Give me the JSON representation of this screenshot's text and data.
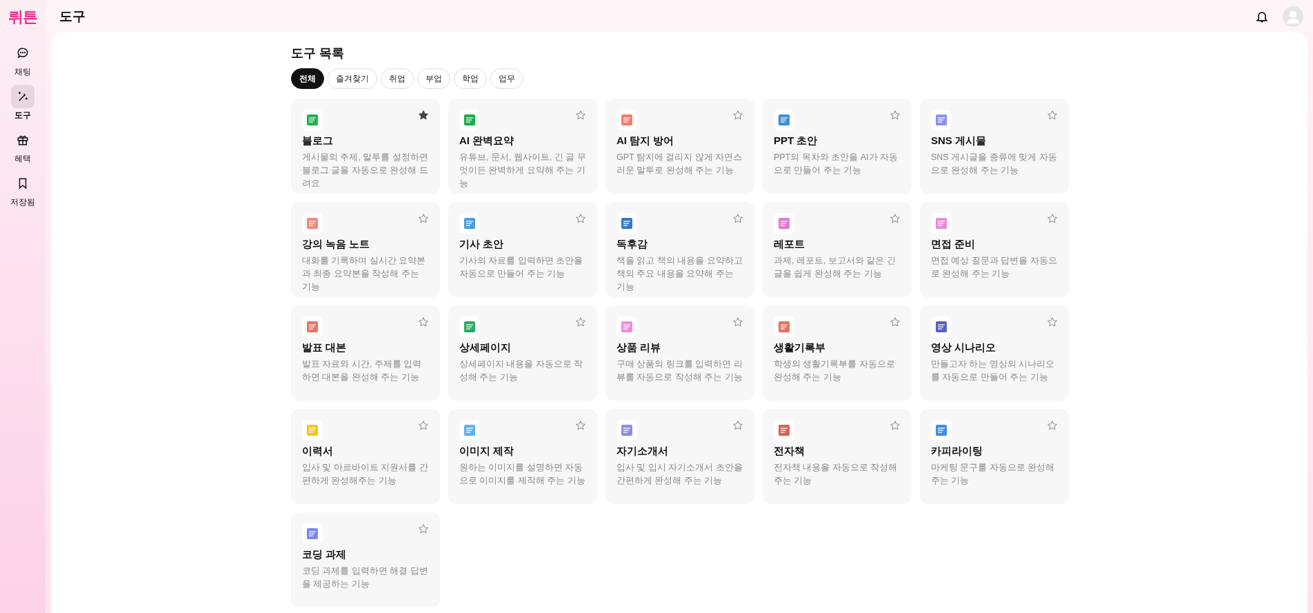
{
  "logo": "뤼튼",
  "header": {
    "title": "도구"
  },
  "sidebar": {
    "items": [
      {
        "label": "채팅",
        "selected": false
      },
      {
        "label": "도구",
        "selected": true
      },
      {
        "label": "혜택",
        "selected": false
      },
      {
        "label": "저장됨",
        "selected": false
      }
    ]
  },
  "section_title": "도구 목록",
  "filters": [
    {
      "label": "전체",
      "selected": true
    },
    {
      "label": "즐겨찾기",
      "selected": false
    },
    {
      "label": "취업",
      "selected": false
    },
    {
      "label": "부업",
      "selected": false
    },
    {
      "label": "학업",
      "selected": false
    },
    {
      "label": "업무",
      "selected": false
    }
  ],
  "tools": [
    {
      "title": "블로그",
      "description": "게시물의 주제, 말투를 설정하면 블로그 글을 자동으로 완성해 드려요",
      "favorite": true
    },
    {
      "title": "AI 완벽요약",
      "description": "유튜브, 문서, 웹사이트, 긴 글 무엇이든 완벽하게 요약해 주는 기능",
      "favorite": false
    },
    {
      "title": "AI 탐지 방어",
      "description": "GPT 탐지에 걸리지 않게 자연스러운 말투로 완성해 주는 기능",
      "favorite": false
    },
    {
      "title": "PPT 초안",
      "description": "PPT의 목차와 초안을 AI가 자동으로 만들어 주는 기능",
      "favorite": false
    },
    {
      "title": "SNS 게시물",
      "description": "SNS 게시글을 종류에 맞게 자동으로 완성해 주는 기능",
      "favorite": false
    },
    {
      "title": "강의 녹음 노트",
      "description": "대화를 기록하며 실시간 요약본과 최종 요약본을 작성해 주는 기능",
      "favorite": false
    },
    {
      "title": "기사 초안",
      "description": "기사의 자료를 입력하면 초안을 자동으로 만들어 주는 기능",
      "favorite": false
    },
    {
      "title": "독후감",
      "description": "책을 읽고 책의 내용을 요약하고 책의 주요 내용을 요약해 주는 기능",
      "favorite": false
    },
    {
      "title": "레포트",
      "description": "과제, 레포트, 보고서와 같은 긴 글을 쉽게 완성해 주는 기능",
      "favorite": false
    },
    {
      "title": "면접 준비",
      "description": "면접 예상 질문과 답변을 자동으로 완성해 주는 기능",
      "favorite": false
    },
    {
      "title": "발표 대본",
      "description": "발표 자료와 시간, 주제를 입력하면 대본을 완성해 주는 기능",
      "favorite": false
    },
    {
      "title": "상세페이지",
      "description": "상세페이지 내용을 자동으로 작성해 주는 기능",
      "favorite": false
    },
    {
      "title": "상품 리뷰",
      "description": "구매 상품의 링크를 입력하면 리뷰를 자동으로 작성해 주는 기능",
      "favorite": false
    },
    {
      "title": "생활기록부",
      "description": "학생의 생활기록부를 자동으로 완성해 주는 기능",
      "favorite": false
    },
    {
      "title": "영상 시나리오",
      "description": "만들고자 하는 영상의 시나리오를 자동으로 만들어 주는 기능",
      "favorite": false
    },
    {
      "title": "이력서",
      "description": "입사 및 아르바이트 지원서를 간편하게 완성해주는 기능",
      "favorite": false
    },
    {
      "title": "이미지 제작",
      "description": "원하는 이미지를 설명하면 자동으로 이미지를 제작해 주는 기능",
      "favorite": false
    },
    {
      "title": "자기소개서",
      "description": "입사 및 입시 자기소개서 초안을 간편하게 완성해 주는 기능",
      "favorite": false
    },
    {
      "title": "전자책",
      "description": "전자책 내용을 자동으로 작성해 주는 기능",
      "favorite": false
    },
    {
      "title": "카피라이팅",
      "description": "마케팅 문구를 자동으로 완성해 주는 기능",
      "favorite": false
    },
    {
      "title": "코딩 과제",
      "description": "코딩 과제를 입력하면 해결 답변을 제공하는 기능",
      "favorite": false
    }
  ]
}
